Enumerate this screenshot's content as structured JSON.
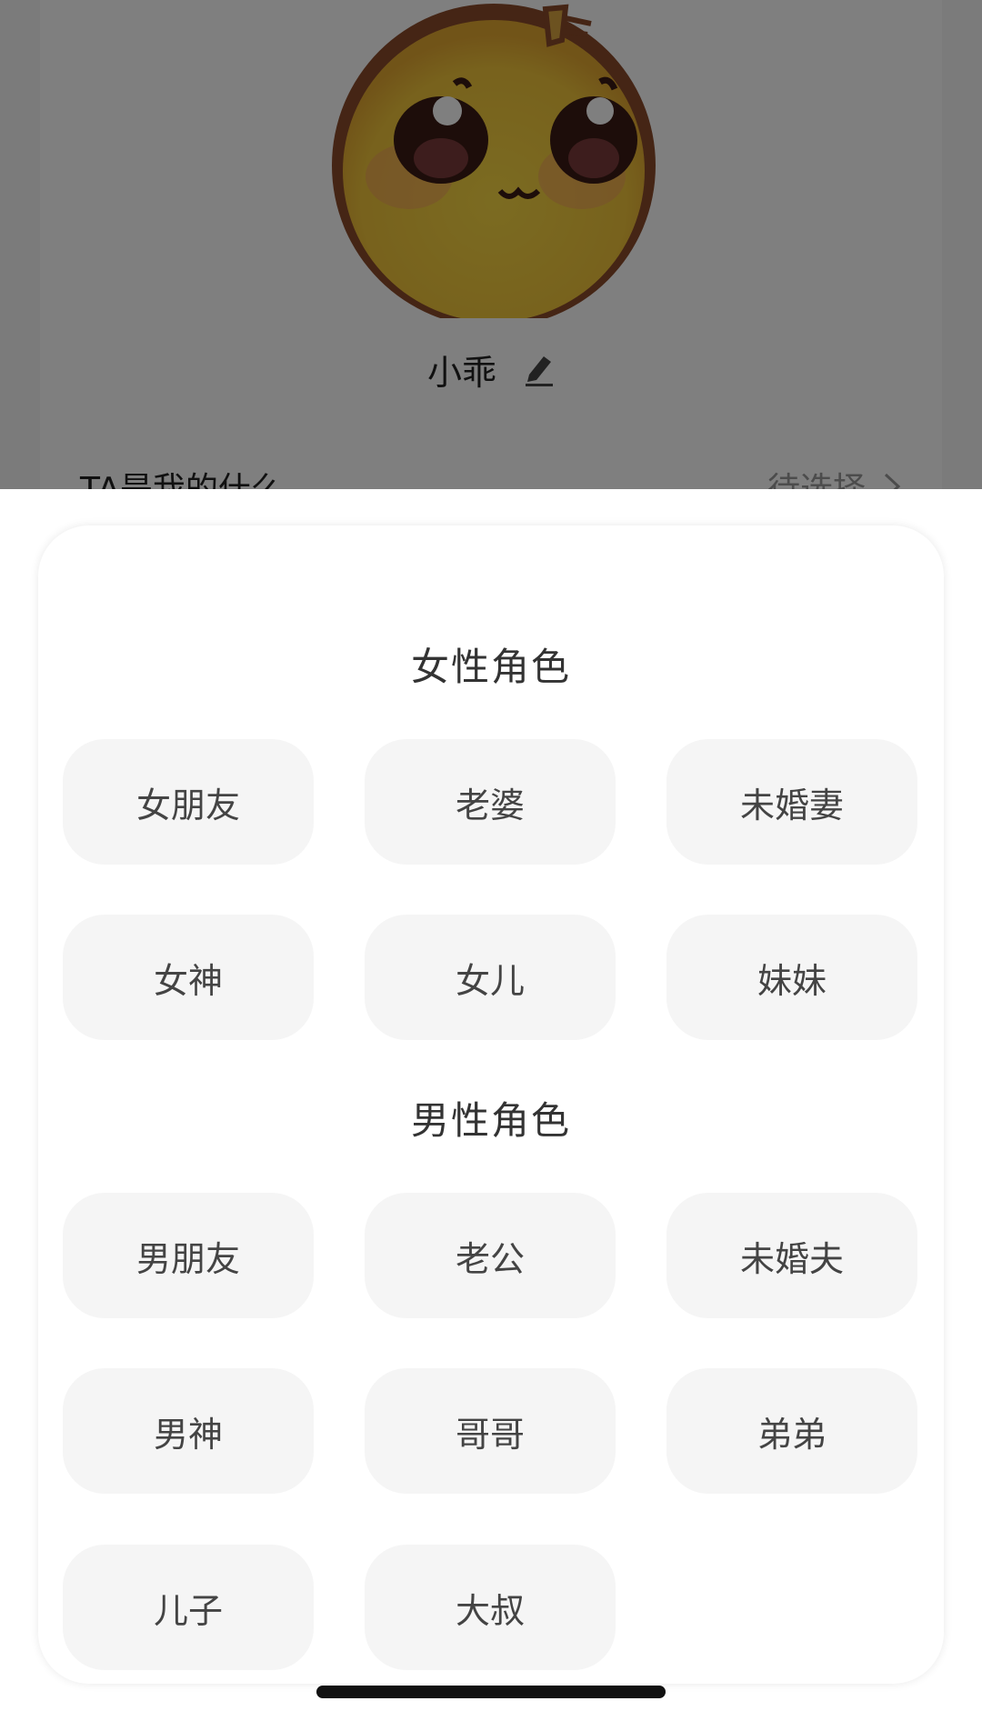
{
  "background": {
    "profile_name": "小乖",
    "relation_label": "TA是我的什么",
    "relation_value": "待选择"
  },
  "role_picker": {
    "female": {
      "title": "女性角色",
      "roles": [
        "女朋友",
        "老婆",
        "未婚妻",
        "女神",
        "女儿",
        "妹妹"
      ]
    },
    "male": {
      "title": "男性角色",
      "roles": [
        "男朋友",
        "老公",
        "未婚夫",
        "男神",
        "哥哥",
        "弟弟",
        "儿子",
        "大叔"
      ]
    }
  },
  "icons": {
    "avatar": "yellow-emoji-character",
    "edit": "pencil-icon",
    "relation_arrow": "chevron-right-icon"
  },
  "colors": {
    "overlay": "#000000",
    "button_bg": "#f5f5f5",
    "text_primary": "#333333",
    "text_secondary": "#999999"
  }
}
